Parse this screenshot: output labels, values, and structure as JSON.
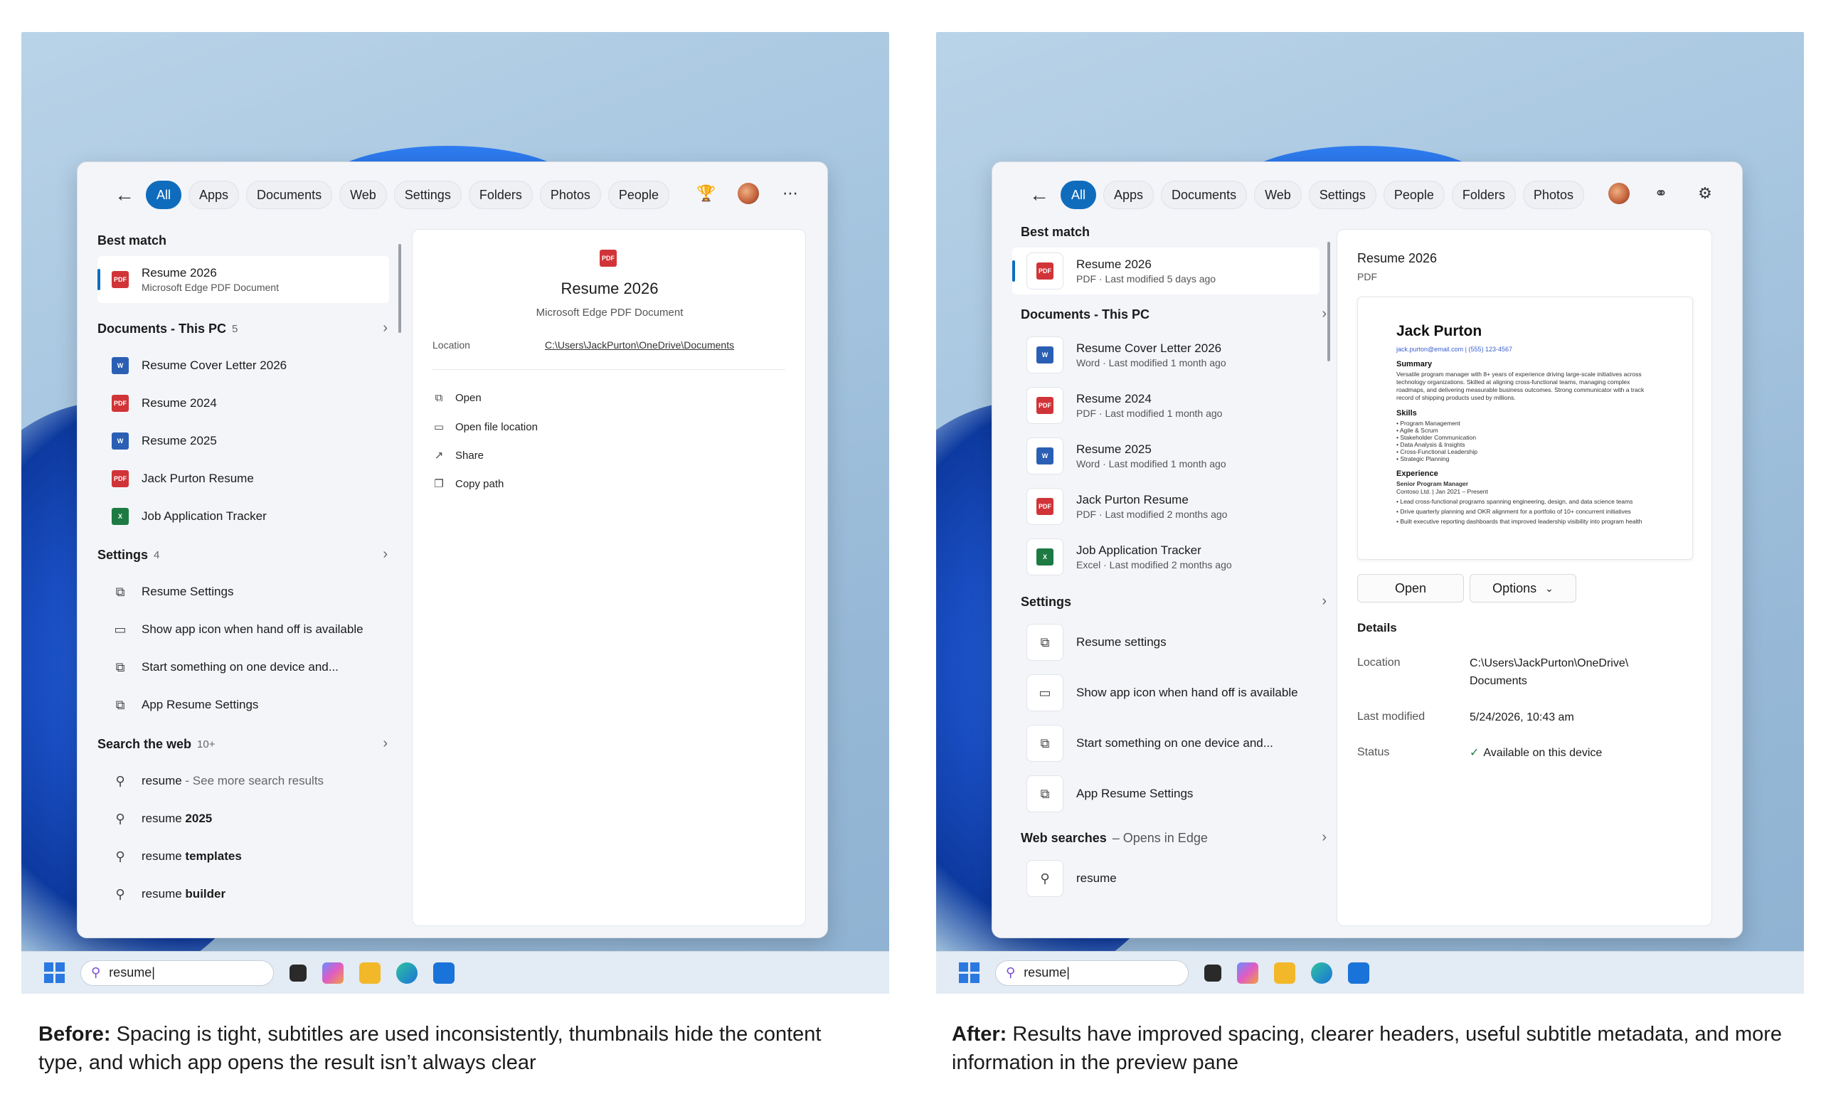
{
  "before": {
    "filters": [
      "All",
      "Apps",
      "Documents",
      "Web",
      "Settings",
      "Folders",
      "Photos",
      "People"
    ],
    "best_match": {
      "header": "Best match",
      "title": "Resume 2026",
      "subtitle": "Microsoft Edge PDF Document"
    },
    "documents": {
      "header": "Documents - This PC",
      "count": "5",
      "items": [
        "Resume Cover Letter 2026",
        "Resume 2024",
        "Resume 2025",
        "Jack Purton Resume",
        "Job Application Tracker"
      ]
    },
    "settings": {
      "header": "Settings",
      "count": "4",
      "items": [
        "Resume Settings",
        "Show app icon when hand off is available",
        "Start something on one device and...",
        "App Resume Settings"
      ]
    },
    "web": {
      "header": "Search the web",
      "count": "10+",
      "items": [
        {
          "query": "resume",
          "suffix": " - See more search results"
        },
        {
          "query": "resume ",
          "suffix": "2025"
        },
        {
          "query": "resume ",
          "suffix": "templates"
        },
        {
          "query": "resume ",
          "suffix": "builder"
        }
      ]
    },
    "preview": {
      "title": "Resume 2026",
      "subtitle": "Microsoft Edge PDF Document",
      "location_label": "Location",
      "location_value": "C:\\Users\\JackPurton\\OneDrive\\Documents",
      "actions": [
        "Open",
        "Open file location",
        "Share",
        "Copy path"
      ]
    }
  },
  "after": {
    "filters": [
      "All",
      "Apps",
      "Documents",
      "Web",
      "Settings",
      "People",
      "Folders",
      "Photos"
    ],
    "best_match": {
      "header": "Best match",
      "title": "Resume 2026",
      "subtitle": "PDF · Last modified 5 days ago"
    },
    "documents": {
      "header": "Documents - This PC",
      "items": [
        {
          "title": "Resume Cover Letter 2026",
          "subtitle": "Word · Last modified 1 month ago"
        },
        {
          "title": "Resume 2024",
          "subtitle": "PDF · Last modified 1 month ago"
        },
        {
          "title": "Resume 2025",
          "subtitle": "Word · Last modified 1 month ago"
        },
        {
          "title": "Jack Purton Resume",
          "subtitle": "PDF · Last modified 2 months ago"
        },
        {
          "title": "Job Application Tracker",
          "subtitle": "Excel · Last modified 2 months ago"
        }
      ]
    },
    "settings": {
      "header": "Settings",
      "items": [
        "Resume settings",
        "Show app icon when hand off is available",
        "Start something on one device and...",
        "App Resume Settings"
      ]
    },
    "web": {
      "header": "Web searches",
      "header_suffix": " – Opens in Edge",
      "items": [
        "resume"
      ]
    },
    "preview": {
      "title": "Resume 2026",
      "subtitle": "PDF",
      "doc": {
        "name": "Jack Purton",
        "contact": "jack.purton@email.com | (555) 123-4567",
        "summary_h": "Summary",
        "summary": "Versatile program manager with 8+ years of experience driving large-scale initiatives across technology organizations. Skilled at aligning cross-functional teams, managing complex roadmaps, and delivering measurable business outcomes. Strong communicator with a track record of shipping products used by millions.",
        "skills_h": "Skills",
        "skills": [
          "• Program Management",
          "• Agile & Scrum",
          "• Stakeholder Communication",
          "• Data Analysis & Insights",
          "• Cross-Functional Leadership",
          "• Strategic Planning"
        ],
        "experience_h": "Experience",
        "role": "Senior Program Manager",
        "company": "Contoso Ltd. | Jan 2021 – Present",
        "bullets": [
          "• Lead cross-functional programs spanning engineering, design, and data science teams",
          "• Drive quarterly planning and OKR alignment for a portfolio of 10+ concurrent initiatives",
          "• Built executive reporting dashboards that improved leadership visibility into program health"
        ]
      },
      "open_label": "Open",
      "options_label": "Options",
      "details_header": "Details",
      "location_label": "Location",
      "location_value": "C:\\Users\\JackPurton\\OneDrive\\ Documents",
      "modified_label": "Last modified",
      "modified_value": "5/24/2026, 10:43 am",
      "status_label": "Status",
      "status_value": "Available on this device"
    }
  },
  "taskbar": {
    "search_value": "resume|"
  },
  "captions": {
    "before_bold": "Before:",
    "before_text": " Spacing is tight, subtitles are used inconsistently, thumbnails hide the content type, and which app opens the result isn’t always clear",
    "after_bold": "After:",
    "after_text": " Results have improved spacing, clearer headers, useful subtitle metadata, and more information in the preview pane"
  },
  "colors": {
    "accent": "#0f6cbd",
    "pdf": "#d13438",
    "word": "#2b5fb4",
    "excel": "#1d7a43",
    "status_ok": "#1d7a43"
  }
}
